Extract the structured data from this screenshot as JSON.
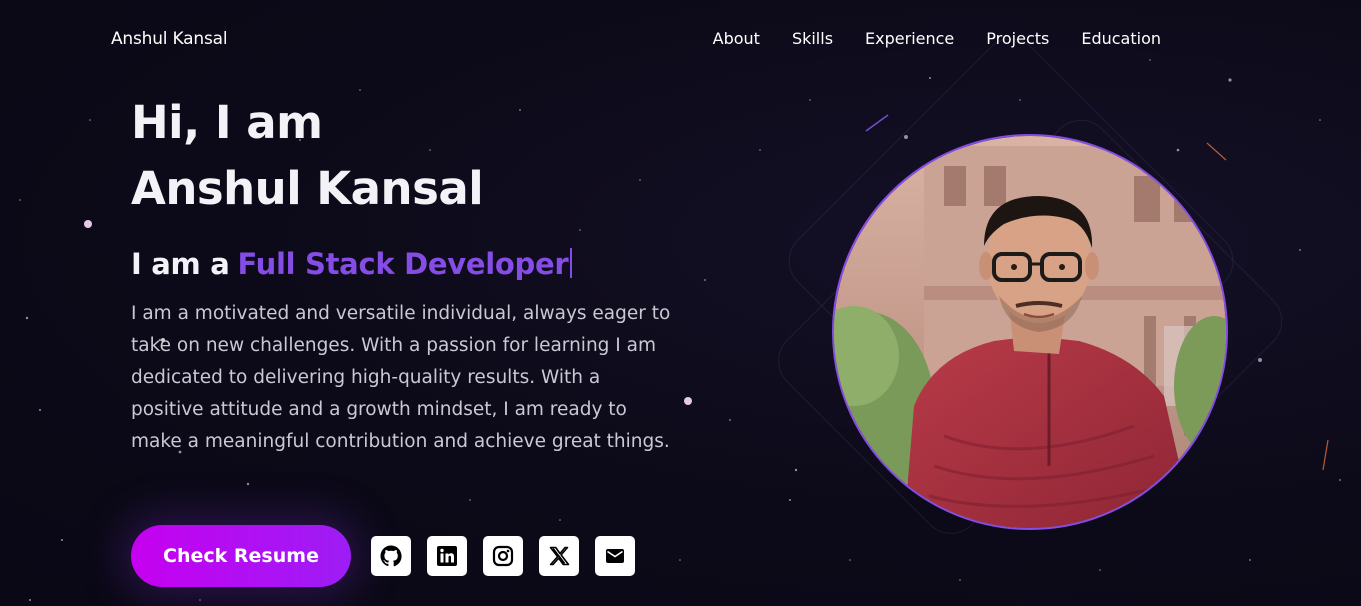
{
  "nav": {
    "brand": "Anshul Kansal",
    "links": [
      {
        "label": "About"
      },
      {
        "label": "Skills"
      },
      {
        "label": "Experience"
      },
      {
        "label": "Projects"
      },
      {
        "label": "Education"
      }
    ]
  },
  "hero": {
    "greeting": "Hi, I am",
    "name": "Anshul Kansal",
    "role_prefix": "I am a",
    "role": "Full Stack Developer",
    "bio": "I am a motivated and versatile individual, always eager to take on new challenges. With a passion for learning I am dedicated to delivering high-quality results. With a positive attitude and a growth mindset, I am ready to make a meaningful contribution and achieve great things.",
    "resume_label": "Check Resume"
  },
  "socials": [
    {
      "icon": "github-icon"
    },
    {
      "icon": "linkedin-icon"
    },
    {
      "icon": "instagram-icon"
    },
    {
      "icon": "x-icon"
    },
    {
      "icon": "mail-icon"
    }
  ],
  "colors": {
    "accent": "#854ce6",
    "button_start": "#c600f0",
    "button_end": "#9d1df5",
    "background": "#0c0a18"
  }
}
